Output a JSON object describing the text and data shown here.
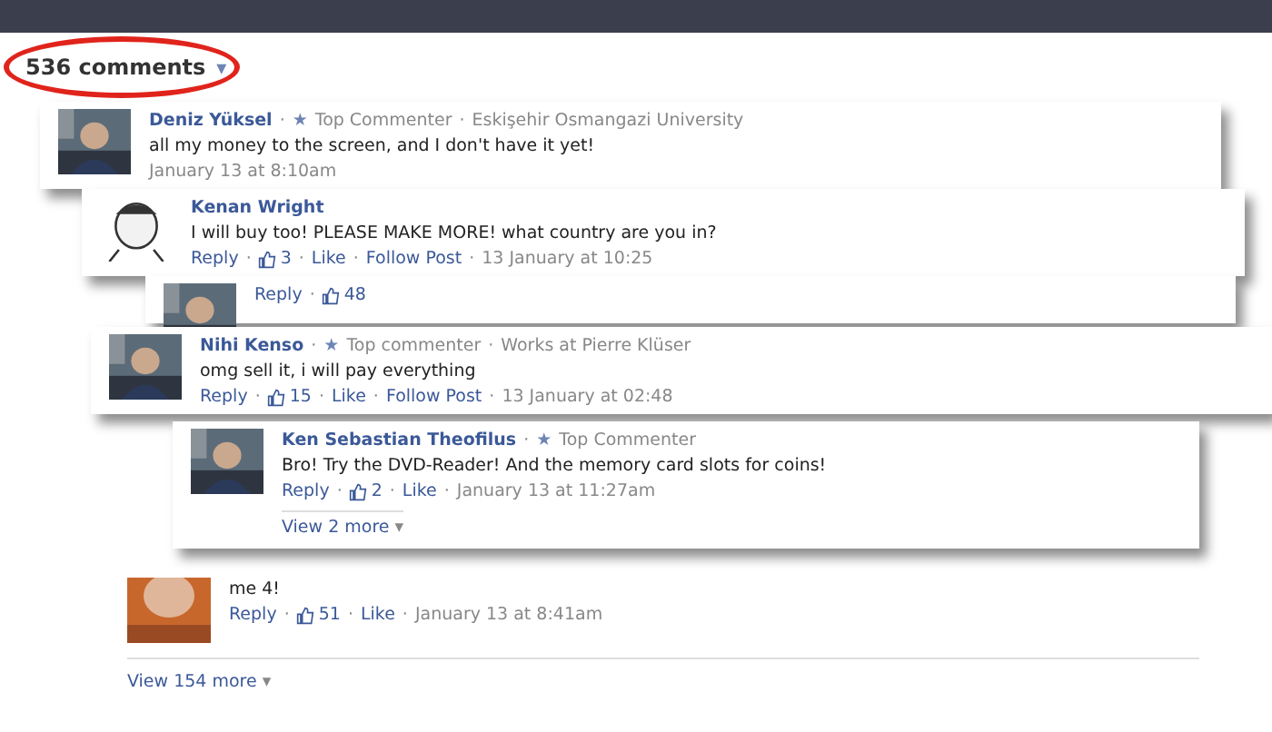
{
  "header": {
    "count": "536 comments",
    "caret": "▾",
    "circled": true
  },
  "cards": [
    {
      "name": "Deniz Yüksel",
      "sep": "·",
      "badge": "★",
      "role": "Top Commenter",
      "info": "Eskişehir Osmangazi University",
      "text": "all my money to the screen, and I don't have it yet!",
      "actions": [
        {
          "kind": "time",
          "text": "January 13 at 8:10am"
        }
      ]
    },
    {
      "name": "Kenan Wright",
      "sep": "·",
      "text": "I will buy too! PLEASE MAKE MORE! what country are you in?",
      "actions": [
        {
          "kind": "link",
          "text": "Reply"
        },
        {
          "kind": "likes",
          "text": "3"
        },
        {
          "kind": "link",
          "text": "Like"
        },
        {
          "kind": "link",
          "text": "Follow Post"
        },
        {
          "kind": "time",
          "text": "13 January at 10:25"
        }
      ]
    },
    {
      "sep": "·",
      "actions": [
        {
          "kind": "link",
          "text": "Reply"
        },
        {
          "kind": "likes",
          "text": "48"
        }
      ]
    },
    {
      "name": "Nihi Kenso",
      "sep": "·",
      "badge": "★",
      "role": "Top commenter",
      "info": "Works at Pierre Klüser",
      "text": "omg sell it, i will pay everything",
      "actions": [
        {
          "kind": "link",
          "text": "Reply"
        },
        {
          "kind": "likes",
          "text": "15"
        },
        {
          "kind": "link",
          "text": "Like"
        },
        {
          "kind": "link",
          "text": "Follow Post"
        },
        {
          "kind": "time",
          "text": "13 January at 02:48"
        }
      ]
    },
    {
      "name": "Ken Sebastian Theofilus",
      "sep": "·",
      "badge": "★",
      "role": "Top Commenter",
      "text": "Bro! Try the DVD-Reader! And the memory card slots for coins!",
      "actions": [
        {
          "kind": "link",
          "text": "Reply"
        },
        {
          "kind": "likes",
          "text": "2"
        },
        {
          "kind": "link",
          "text": "Like"
        },
        {
          "kind": "time",
          "text": "January 13 at 11:27am"
        }
      ],
      "more": "View 2 more",
      "caret": "▾"
    }
  ],
  "bottom": {
    "text": "me 4!",
    "sep": "·",
    "actions": [
      {
        "kind": "link",
        "text": "Reply"
      },
      {
        "kind": "likes",
        "text": "51"
      },
      {
        "kind": "link",
        "text": "Like"
      },
      {
        "kind": "time",
        "text": "January 13 at 8:41am"
      }
    ],
    "more": "View 154 more",
    "caret": "▾"
  }
}
